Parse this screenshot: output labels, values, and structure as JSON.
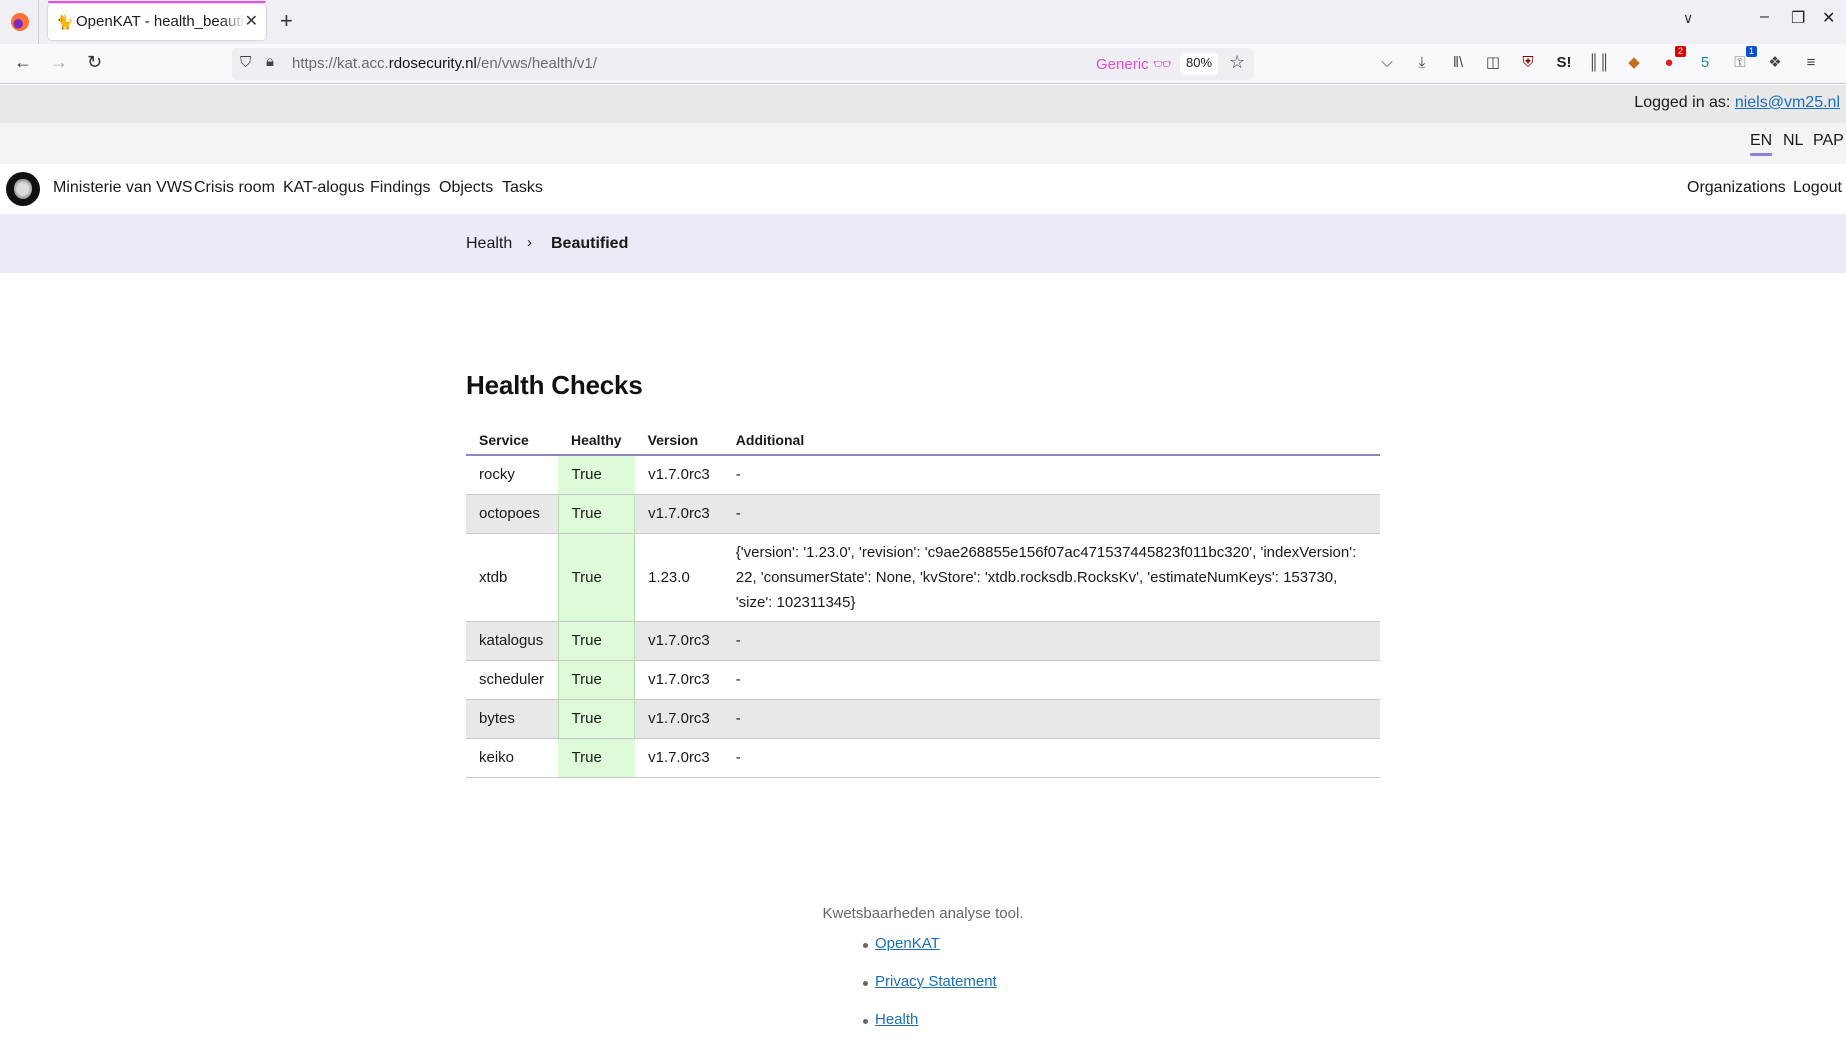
{
  "browser": {
    "tab_title": "OpenKAT - health_beautified",
    "tab_close_icon": "close-icon",
    "new_tab_icon": "plus-icon",
    "url_prefix": "https://kat.acc.",
    "url_domain": "rdosecurity.nl",
    "url_path": "/en/vws/health/v1/",
    "reader_label": "Generic",
    "zoom_level": "80%",
    "extensions": [
      {
        "name": "pocket-icon",
        "glyph": "⌵"
      },
      {
        "name": "download-icon",
        "glyph": "⤓"
      },
      {
        "name": "library-icon",
        "glyph": "‖\\"
      },
      {
        "name": "sidebar-icon",
        "glyph": "◫"
      },
      {
        "name": "ublock-icon",
        "glyph": "⛨"
      },
      {
        "name": "stylus-icon",
        "glyph": "S!"
      },
      {
        "name": "grid-extension-icon",
        "glyph": "║║"
      },
      {
        "name": "badger-icon",
        "glyph": "◆"
      },
      {
        "name": "red-extension-icon",
        "glyph": "●",
        "badge": "2"
      },
      {
        "name": "shield-5-icon",
        "glyph": "5"
      },
      {
        "name": "password-manager-icon",
        "glyph": "⚿",
        "badge": "1"
      },
      {
        "name": "extensions-icon",
        "glyph": "❖"
      },
      {
        "name": "menu-icon",
        "glyph": "≡"
      }
    ]
  },
  "session": {
    "logged_in_label": "Logged in as:",
    "user_email": "niels@vm25.nl"
  },
  "languages": [
    {
      "code": "EN",
      "active": true
    },
    {
      "code": "NL",
      "active": false
    },
    {
      "code": "PAP",
      "active": false
    }
  ],
  "nav": {
    "organization": "Ministerie van VWS",
    "items": [
      "Crisis room",
      "KAT-alogus",
      "Findings",
      "Objects",
      "Tasks"
    ],
    "right_items": [
      "Organizations",
      "Logout"
    ]
  },
  "breadcrumb": {
    "items": [
      "Health",
      "Beautified"
    ],
    "separator": "›"
  },
  "page": {
    "title": "Health Checks"
  },
  "table": {
    "headers": [
      "Service",
      "Healthy",
      "Version",
      "Additional"
    ],
    "rows": [
      {
        "service": "rocky",
        "healthy": "True",
        "version": "v1.7.0rc3",
        "additional": "-"
      },
      {
        "service": "octopoes",
        "healthy": "True",
        "version": "v1.7.0rc3",
        "additional": "-"
      },
      {
        "service": "xtdb",
        "healthy": "True",
        "version": "1.23.0",
        "additional": "{'version': '1.23.0', 'revision': 'c9ae268855e156f07ac471537445823f011bc320', 'indexVersion': 22, 'consumerState': None, 'kvStore': 'xtdb.rocksdb.RocksKv', 'estimateNumKeys': 153730, 'size': 102311345}"
      },
      {
        "service": "katalogus",
        "healthy": "True",
        "version": "v1.7.0rc3",
        "additional": "-"
      },
      {
        "service": "scheduler",
        "healthy": "True",
        "version": "v1.7.0rc3",
        "additional": "-"
      },
      {
        "service": "bytes",
        "healthy": "True",
        "version": "v1.7.0rc3",
        "additional": "-"
      },
      {
        "service": "keiko",
        "healthy": "True",
        "version": "v1.7.0rc3",
        "additional": "-"
      }
    ]
  },
  "footer": {
    "tagline": "Kwetsbaarheden analyse tool.",
    "links": [
      "OpenKAT",
      "Privacy Statement",
      "Health"
    ]
  },
  "colors": {
    "healthy_bg": "#dffad8",
    "accent": "#8f84c8",
    "breadcrumb_bg": "#edeaf7",
    "link": "#1a6fb7"
  }
}
